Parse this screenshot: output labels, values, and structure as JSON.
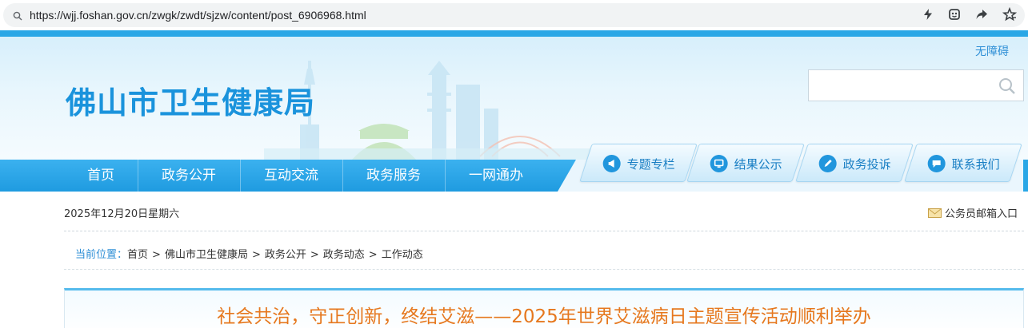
{
  "browser": {
    "url": "https://wjj.foshan.gov.cn/zwgk/zwdt/sjzw/content/post_6906968.html",
    "icons": [
      "search-icon",
      "lightning-icon",
      "extension-icon",
      "share-icon",
      "star-icon"
    ]
  },
  "header": {
    "site_title": "佛山市卫生健康局",
    "accessible_link": "无障碍",
    "search_placeholder": ""
  },
  "nav": {
    "items": [
      {
        "label": "首页"
      },
      {
        "label": "政务公开"
      },
      {
        "label": "互动交流"
      },
      {
        "label": "政务服务"
      },
      {
        "label": "一网通办"
      }
    ]
  },
  "quick_links": [
    {
      "label": "专题专栏",
      "icon": "megaphone-icon"
    },
    {
      "label": "结果公示",
      "icon": "monitor-icon"
    },
    {
      "label": "政务投诉",
      "icon": "pen-icon"
    },
    {
      "label": "联系我们",
      "icon": "chat-icon"
    }
  ],
  "info_bar": {
    "date": "2025年12月20日星期六",
    "mailbox": "公务员邮箱入口"
  },
  "breadcrumb": {
    "label": "当前位置：",
    "items": [
      "首页",
      "佛山市卫生健康局",
      "政务公开",
      "政务动态",
      "工作动态"
    ]
  },
  "article": {
    "title": "社会共治，守正创新，终结艾滋——2025年世界艾滋病日主题宣传活动顺利举办"
  },
  "colors": {
    "brand_blue": "#1a93dc",
    "nav_blue": "#2aa7e6",
    "title_orange": "#e6781e"
  }
}
